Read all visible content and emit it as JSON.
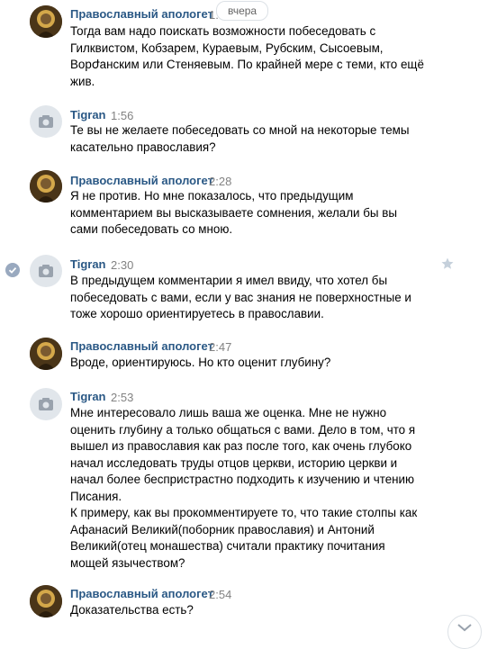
{
  "date_pill": "вчера",
  "messages": [
    {
      "author": "Православный апологет",
      "time": "1:",
      "avatar": "photo",
      "lines": [
        "Тогда вам надо поискать возможности побеседовать с",
        "Гилквистом, Кобзарем, Кураевым, Рубским, Сысоевым,",
        "Ворժанским или Стеняевым. По крайней мере с теми, кто ещё",
        "жив."
      ]
    },
    {
      "author": "Tigran",
      "time": "1:56",
      "avatar": "camera",
      "lines": [
        "Те вы не желаете побеседовать со мной на некоторые темы",
        "касательно православия?"
      ]
    },
    {
      "author": "Православный апологет",
      "time": "2:28",
      "avatar": "photo",
      "lines": [
        "Я не против. Но мне показалось, что предыдущим",
        "комментарием вы высказываете сомнения, желали бы вы",
        "сами побеседовать со мною."
      ]
    },
    {
      "author": "Tigran",
      "time": "2:30",
      "avatar": "camera",
      "lines": [
        "В предыдущем комментарии я имел ввиду, что хотел бы",
        "побеседовать с вами, если у вас знания не поверхностные и",
        "тоже хорошо ориентируетесь в православии."
      ]
    },
    {
      "author": "Православный апологет",
      "time": "2:47",
      "avatar": "photo",
      "lines": [
        "Вроде, ориентируюсь. Но кто оценит глубину?"
      ]
    },
    {
      "author": "Tigran",
      "time": "2:53",
      "avatar": "camera",
      "lines": [
        "Мне интересовало лишь ваша же оценка. Мне не нужно",
        "оценить глубину а только общаться с вами. Дело в том, что я",
        "вышел из православия как раз после того, как очень глубоко",
        "начал исследовать труды отцов церкви, историю церкви и",
        "начал более беспристрастно подходить к изучению и чтению",
        "Писания.",
        "К примеру, как вы прокомментируете то, что такие столпы как",
        "Афанасий Великий(поборник православия) и Антоний",
        "Великий(отец монашества) считали практику почитания",
        "мощей язычеством?"
      ]
    },
    {
      "author": "Православный апологет",
      "time": "2:54",
      "avatar": "photo",
      "lines": [
        "Доказательства есть?"
      ]
    }
  ]
}
